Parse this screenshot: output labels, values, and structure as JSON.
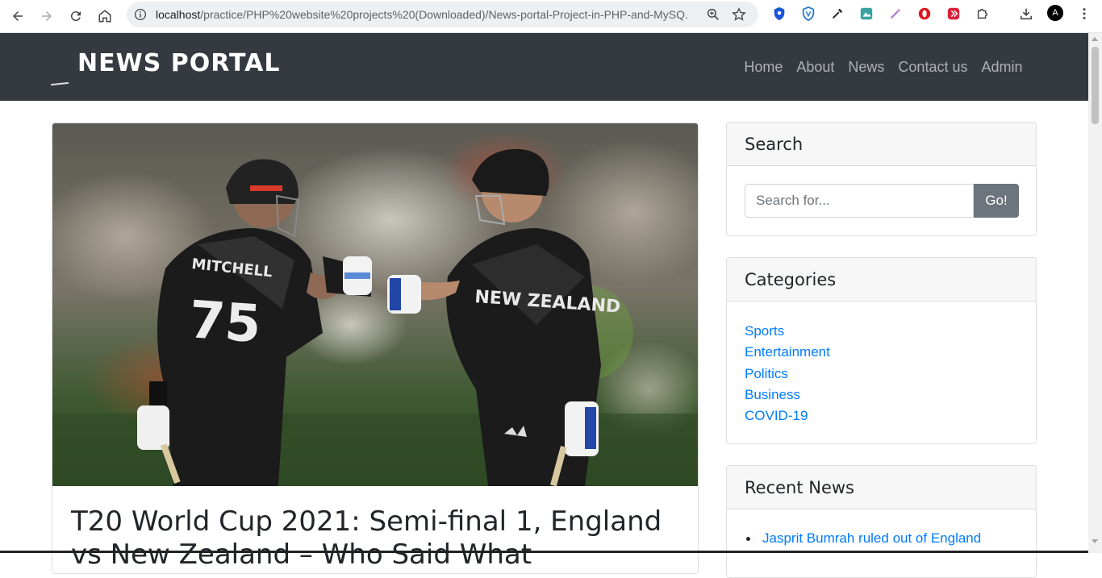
{
  "browser": {
    "url_host": "localhost",
    "url_path": "/practice/PHP%20website%20projects%20(Downloaded)/News-portal-Project-in-PHP-and-MySQ...",
    "profile_initial": "A"
  },
  "site": {
    "brand": "NEWS PORTAL",
    "nav": [
      "Home",
      "About",
      "News",
      "Contact us",
      "Admin"
    ]
  },
  "article": {
    "title": "T20 World Cup 2021: Semi-final 1, England vs New Zealand – Who Said What",
    "image_text": {
      "jersey_name": "MITCHELL",
      "jersey_number": "75",
      "jersey_team": "NEW ZEALAND"
    }
  },
  "sidebar": {
    "search": {
      "title": "Search",
      "placeholder": "Search for...",
      "button": "Go!"
    },
    "categories": {
      "title": "Categories",
      "items": [
        "Sports",
        "Entertainment",
        "Politics",
        "Business",
        "COVID-19"
      ]
    },
    "recent": {
      "title": "Recent News",
      "items": [
        "Jasprit Bumrah ruled out of England"
      ]
    }
  },
  "colors": {
    "navbar": "#343a40",
    "link": "#007bff",
    "button": "#6c757d"
  }
}
